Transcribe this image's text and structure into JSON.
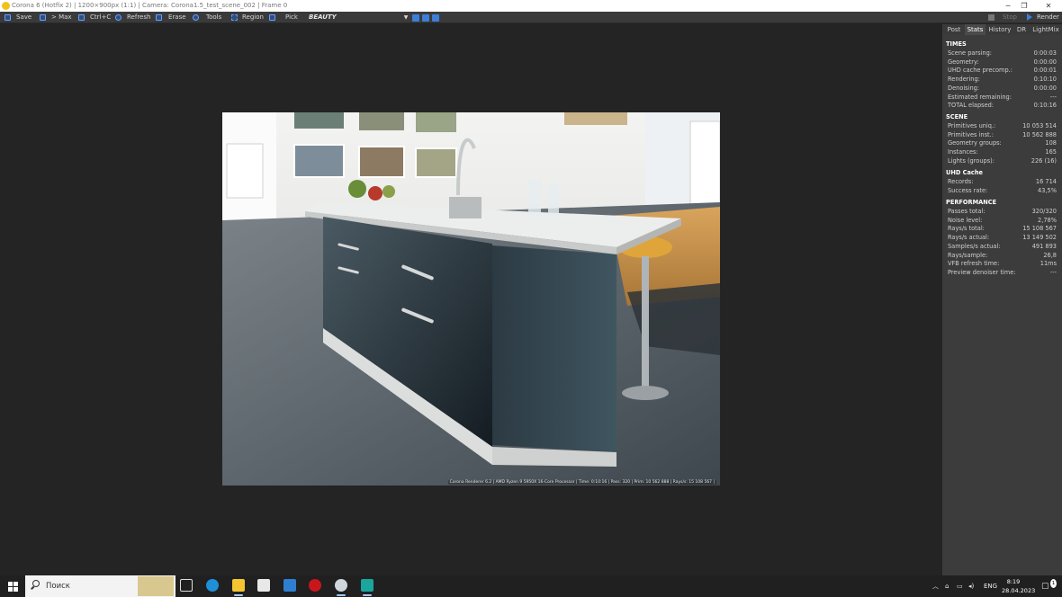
{
  "window": {
    "title": "Corona 6 (Hotfix 2) | 1200×900px (1:1) | Camera: Corona1.5_test_scene_002 | Frame 0",
    "controls": [
      "─",
      "❐",
      "✕"
    ]
  },
  "toolbar": {
    "save": "Save",
    "max": "> Max",
    "copy": "Ctrl+C",
    "refresh": "Refresh",
    "erase": "Erase",
    "tools": "Tools",
    "region": "Region",
    "pick": "Pick",
    "pass": "BEAUTY",
    "stop": "Stop",
    "render": "Render"
  },
  "render_stamp": "Corona Renderer 6.2 | AMD Ryzen 9 5950X 16-Core Processor  | Time: 0:10:16 | Pass: 320 | Prim: 10 562 888 | Rays/s: 15 108 567 |",
  "panel": {
    "tabs": [
      "Post",
      "Stats",
      "History",
      "DR",
      "LightMix"
    ],
    "active_tab": "Stats",
    "sections": [
      {
        "title": "TIMES",
        "rows": [
          {
            "k": "Scene parsing:",
            "v": "0:00:03"
          },
          {
            "k": "Geometry:",
            "v": "0:00:00"
          },
          {
            "k": "UHD cache precomp.:",
            "v": "0:00:01"
          },
          {
            "k": "Rendering:",
            "v": "0:10:10"
          },
          {
            "k": "Denoising:",
            "v": "0:00:00"
          },
          {
            "k": "Estimated remaining:",
            "v": "---"
          },
          {
            "k": "TOTAL elapsed:",
            "v": "0:10:16"
          }
        ]
      },
      {
        "title": "SCENE",
        "rows": [
          {
            "k": "Primitives uniq.:",
            "v": "10 053 514"
          },
          {
            "k": "Primitives inst.:",
            "v": "10 562 888"
          },
          {
            "k": "Geometry groups:",
            "v": "108"
          },
          {
            "k": "Instances:",
            "v": "165"
          },
          {
            "k": "Lights (groups):",
            "v": "226 (16)"
          }
        ]
      },
      {
        "title": "UHD Cache",
        "rows": [
          {
            "k": "Records:",
            "v": "16 714"
          },
          {
            "k": "Success rate:",
            "v": "43,5%"
          }
        ]
      },
      {
        "title": "PERFORMANCE",
        "rows": [
          {
            "k": "Passes total:",
            "v": "320/320"
          },
          {
            "k": "Noise level:",
            "v": "2,78%"
          },
          {
            "k": "Rays/s total:",
            "v": "15 108 567"
          },
          {
            "k": "Rays/s actual:",
            "v": "13 149 502"
          },
          {
            "k": "Samples/s actual:",
            "v": "491 893"
          },
          {
            "k": "Rays/sample:",
            "v": "26,8"
          },
          {
            "k": "VFB refresh time:",
            "v": "11ms"
          },
          {
            "k": "Preview denoiser time:",
            "v": "---"
          }
        ]
      }
    ]
  },
  "taskbar": {
    "search_placeholder": "Поиск",
    "language": "ENG",
    "time": "8:19",
    "date": "28.04.2023",
    "notifications": "1"
  },
  "colors": {
    "accent": "#3d7ed8",
    "panel_bg": "#3c3c3c",
    "canvas_bg": "#242424"
  }
}
